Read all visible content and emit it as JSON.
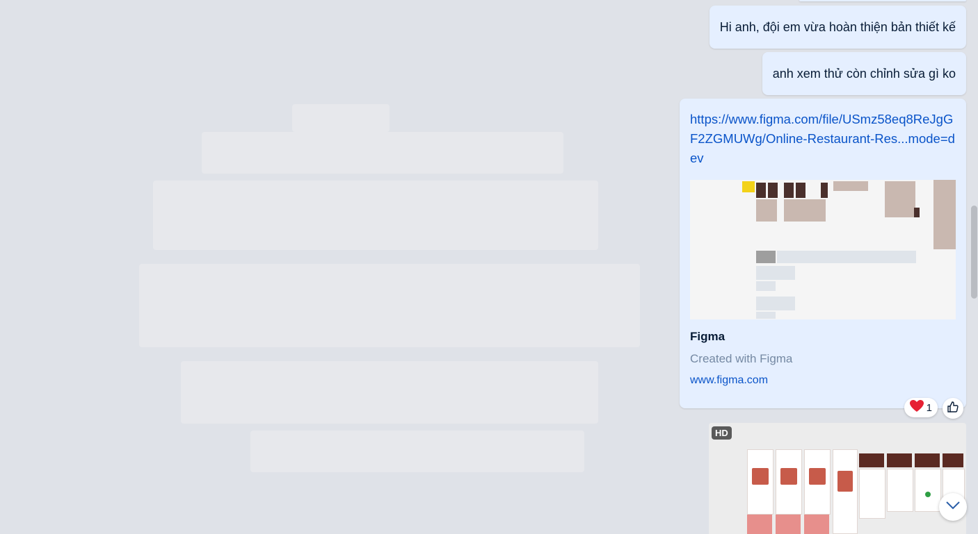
{
  "messages": [
    {
      "text": "Hi anh, đội em vừa hoàn thiện bản thiết kế"
    },
    {
      "text": "anh xem thử còn chỉnh sửa gì ko"
    }
  ],
  "link_card": {
    "url": "https://www.figma.com/file/USmz58eq8ReJgGF2ZGMUWg/Online-Restaurant-Res...mode=dev",
    "title": "Figma",
    "description": "Created with Figma",
    "domain": "www.figma.com"
  },
  "reactions": {
    "emoji": "❤️",
    "count": "1"
  },
  "image_message": {
    "badge": "HD"
  },
  "icons": [
    "heart-icon",
    "thumbs-up-icon",
    "chevron-down-icon"
  ]
}
